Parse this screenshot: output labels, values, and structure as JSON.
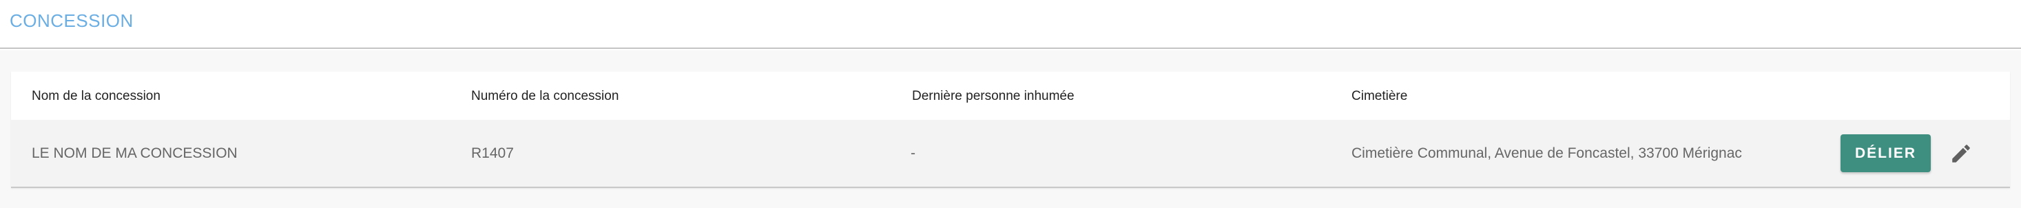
{
  "section": {
    "title": "CONCESSION"
  },
  "table": {
    "columns": [
      "Nom de la concession",
      "Numéro de la concession",
      "Dernière personne inhumée",
      "Cimetière"
    ],
    "rows": [
      {
        "name": "LE NOM DE MA CONCESSION",
        "number": "R1407",
        "last_buried": "-",
        "cemetery": "Cimetière Communal, Avenue de Foncastel, 33700 Mérignac",
        "unlink_label": "DÉLIER",
        "edit_icon": "pencil-icon"
      }
    ]
  },
  "colors": {
    "title": "#6aaee3",
    "button": "#3f8f80",
    "row_bg": "#f3f3f3",
    "page_bg": "#f8f8f8"
  }
}
